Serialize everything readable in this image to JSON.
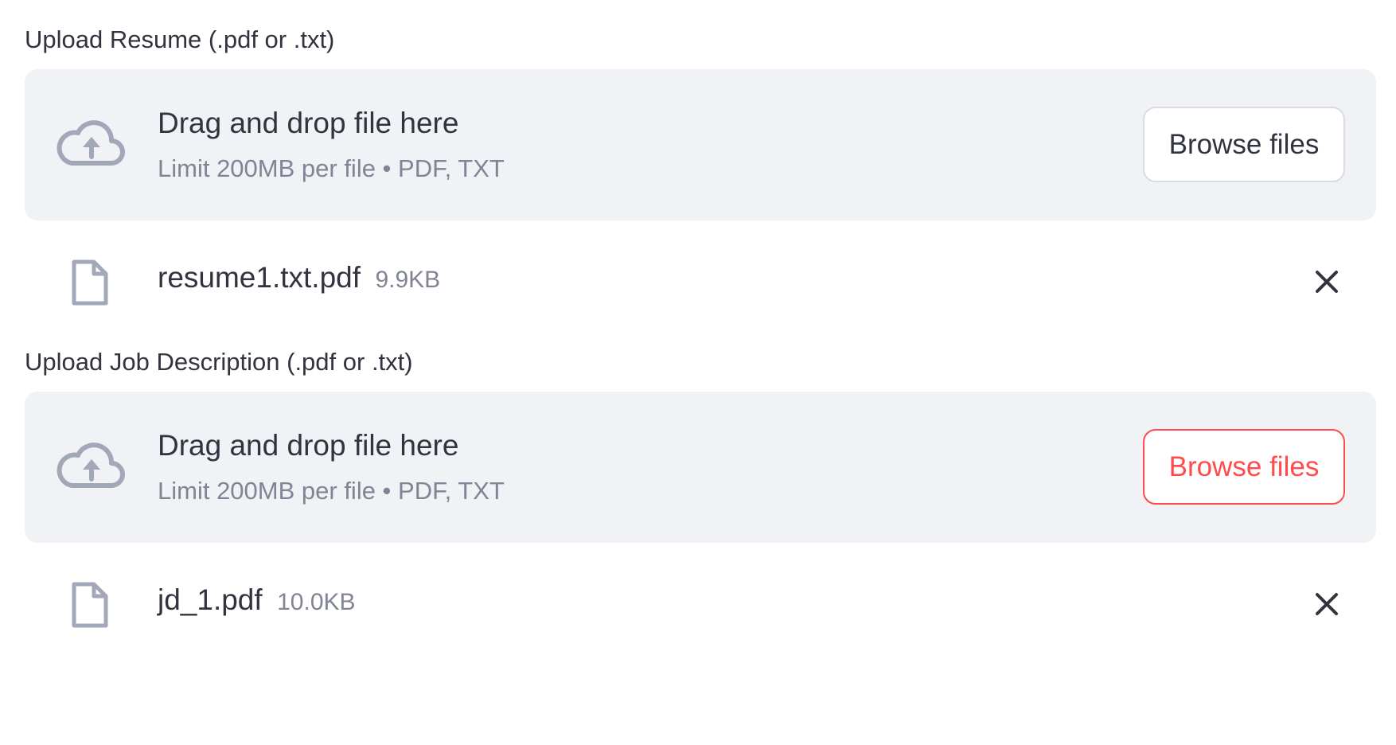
{
  "uploaders": [
    {
      "label": "Upload Resume (.pdf or .txt)",
      "dropzone_title": "Drag and drop file here",
      "dropzone_limit": "Limit 200MB per file • PDF, TXT",
      "browse_label": "Browse files",
      "browse_state": "default",
      "file": {
        "name": "resume1.txt.pdf",
        "size": "9.9KB"
      }
    },
    {
      "label": "Upload Job Description (.pdf or .txt)",
      "dropzone_title": "Drag and drop file here",
      "dropzone_limit": "Limit 200MB per file • PDF, TXT",
      "browse_label": "Browse files",
      "browse_state": "hover",
      "file": {
        "name": "jd_1.pdf",
        "size": "10.0KB"
      }
    }
  ],
  "icons": {
    "upload": "cloud-upload-icon",
    "file": "file-icon",
    "remove": "close-icon"
  },
  "colors": {
    "dropzone_bg": "#f0f2f6",
    "icon": "#a3a8b8",
    "text": "#31333f",
    "muted": "#808495",
    "accent": "#ff4b4b"
  }
}
